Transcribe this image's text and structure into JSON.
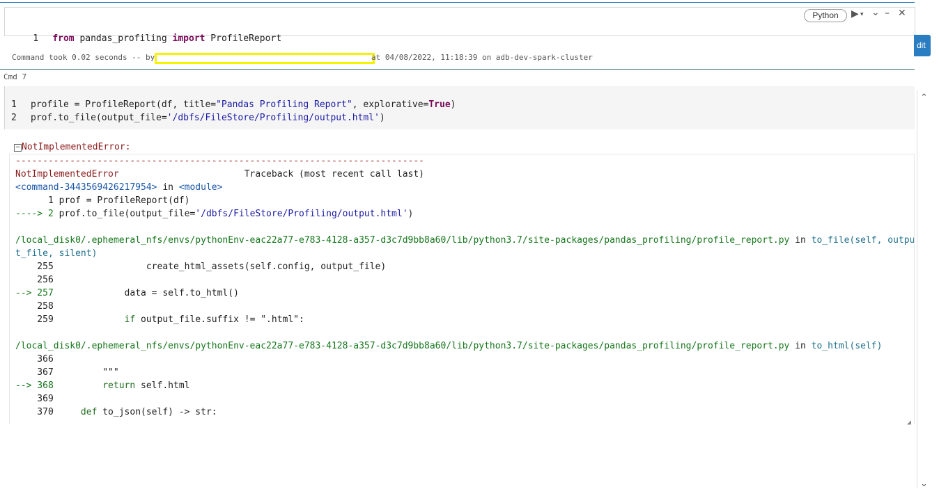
{
  "cell1": {
    "line_number": "1",
    "code_kw1": "from",
    "code_mod": " pandas_profiling ",
    "code_kw2": "import",
    "code_name": " ProfileReport",
    "language": "Python",
    "icons": [
      "run-icon",
      "dropdown-icon",
      "chevron-down-icon",
      "minimize-icon",
      "close-icon"
    ]
  },
  "command_took": {
    "prefix": "Command took 0.02 seconds -- by",
    "suffix": "at 04/08/2022, 11:18:39 on adb-dev-spark-cluster"
  },
  "edit_button": "dit",
  "cmd7_label": "Cmd 7",
  "cell2": {
    "line1_num": "1",
    "line1_a": "profile = ProfileReport(df, title=",
    "line1_str": "\"Pandas Profiling Report\"",
    "line1_b": ", explorative=",
    "line1_true": "True",
    "line1_c": ")",
    "line2_num": "2",
    "line2_a": "prof.to_file(output_file=",
    "line2_str": "'/dbfs/FileStore/Profiling/output.html'",
    "line2_b": ")"
  },
  "error": {
    "header": "NotImplementedError:",
    "dashes": "---------------------------------------------------------------------------",
    "name": "NotImplementedError",
    "traceback": "                       Traceback (most recent call last)",
    "command": "<command-3443569426217954>",
    "in1": " in ",
    "module": "<module>",
    "l1": "      1 prof = ProfileReport(df)",
    "arrow2": "----> 2 ",
    "l2a": "prof.to_file(output_file=",
    "l2str": "'/dbfs/FileStore/Profiling/output.html'",
    "l2b": ")",
    "path1": "/local_disk0/.ephemeral_nfs/envs/pythonEnv-eac22a77-e783-4128-a357-d3c7d9bb8a60/lib/python3.7/site-packages/pandas_profiling/profile_report.py",
    "in2": " in ",
    "func1a": "to_file(self, outpu",
    "func1b": "t_file, silent)",
    "l255": "    255                 create_html_assets(self.config, output_file)",
    "l256": "    256",
    "arrow257": "--> 257             ",
    "l257code": "data = self.to_html()",
    "l258": "    258",
    "l259a": "    259             ",
    "l259kw": "if",
    "l259b": " output_file.suffix != \".html\":",
    "path2": "/local_disk0/.ephemeral_nfs/envs/pythonEnv-eac22a77-e783-4128-a357-d3c7d9bb8a60/lib/python3.7/site-packages/pandas_profiling/profile_report.py",
    "in3": " in ",
    "func2": "to_html(self)",
    "l366": "    366",
    "l367a": "    367         ",
    "l367b": "\"\"\"",
    "arrow368": "--> 368         ",
    "l368kw": "return",
    "l368b": " self.html",
    "l369": "    369",
    "l370a": "    370     ",
    "l370kw": "def",
    "l370b": " to_json(self) -> str:"
  }
}
